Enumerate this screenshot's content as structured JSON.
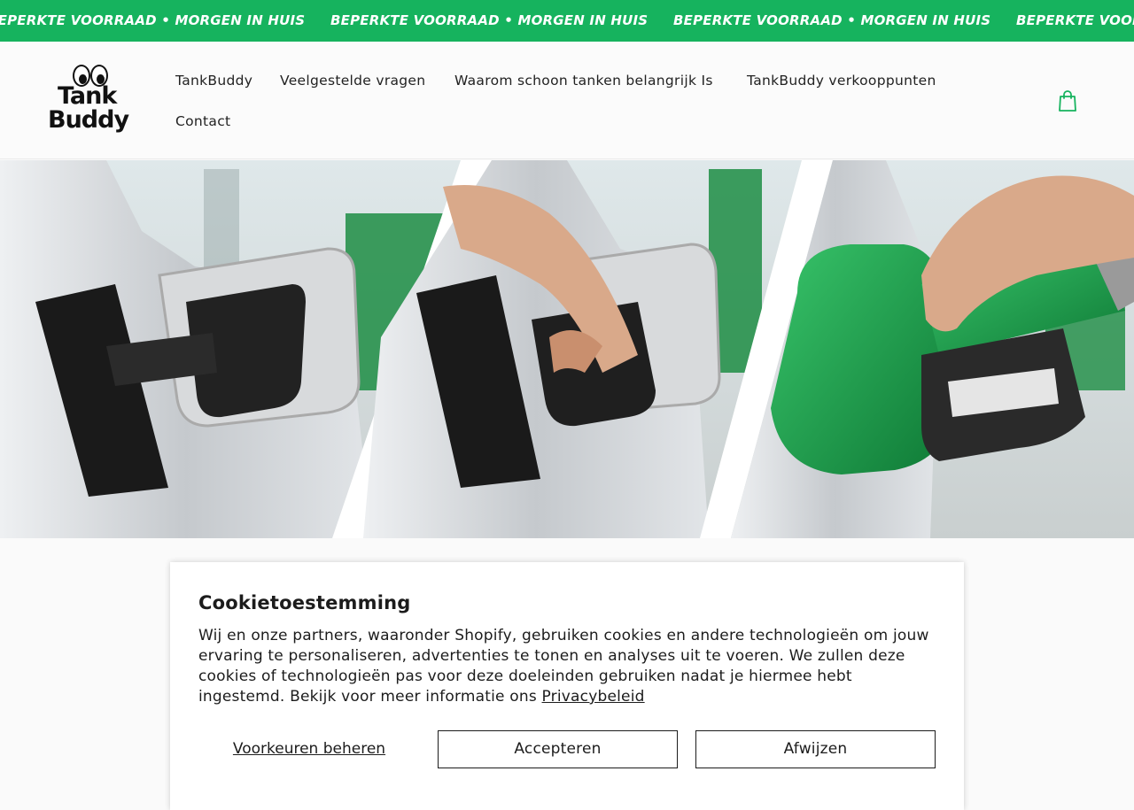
{
  "announcement": {
    "messages": [
      "BEPERKTE VOORRAAD • MORGEN IN HUIS",
      "BEPERKTE VOORRAAD • MORGEN IN HUIS",
      "BEPERKTE VOORRAAD • MORGEN IN HUIS",
      "BEPERKTE VOORRAAD • MORGEN IN HUIS"
    ]
  },
  "logo": {
    "line1": "Tank",
    "line2": "Buddy"
  },
  "nav": {
    "items": [
      {
        "label": "TankBuddy"
      },
      {
        "label": "Veelgestelde vragen"
      },
      {
        "label": "Waarom schoon tanken belangrijk Is"
      },
      {
        "label": "TankBuddy verkooppunten"
      },
      {
        "label": "Contact"
      }
    ]
  },
  "cart": {
    "icon": "shopping-bag-icon"
  },
  "hero": {
    "image": "three-panel photo: fuel cap adapter mounted on car, hand opening it, green fuel nozzle inserted"
  },
  "cookie_banner": {
    "title": "Cookietoestemming",
    "body": "Wij en onze partners, waaronder Shopify, gebruiken cookies en andere technologieën om jouw ervaring te personaliseren, advertenties te tonen en analyses uit te voeren. We zullen deze cookies of technologieën pas voor deze doeleinden gebruiken nadat je hiermee hebt ingestemd. Bekijk voor meer informatie ons",
    "privacy_link": "Privacybeleid",
    "manage_label": "Voorkeuren beheren",
    "accept_label": "Accepteren",
    "decline_label": "Afwijzen"
  },
  "colors": {
    "accent": "#16b35e",
    "text": "#1c1c1c",
    "nozzle": "#1f9a4a"
  }
}
